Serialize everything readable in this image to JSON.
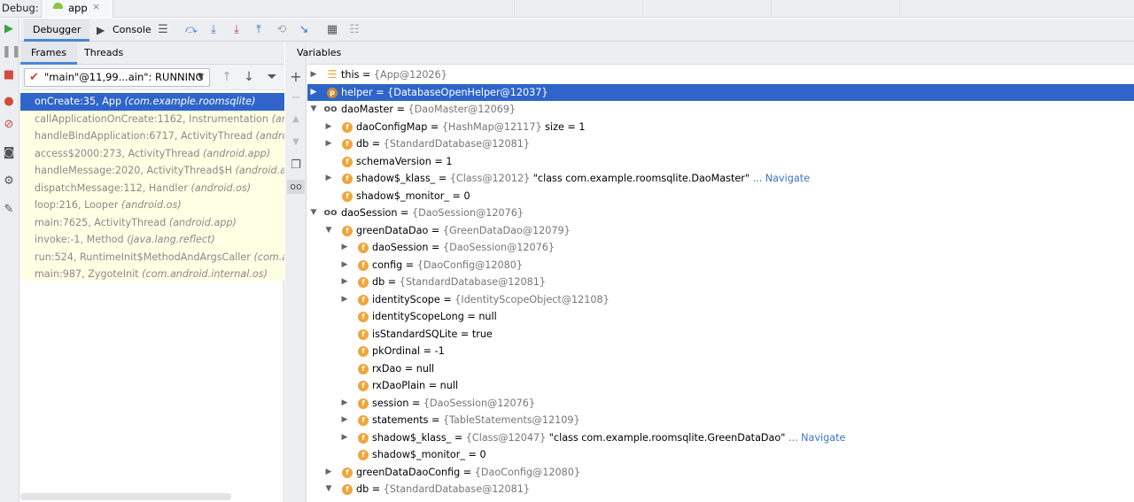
{
  "topbar": {
    "debug_label": "Debug:",
    "app_tab": "app",
    "close": "×"
  },
  "toolbar": {
    "debugger_tab": "Debugger",
    "console_tab": "Console"
  },
  "frames_panel": {
    "frames_tab": "Frames",
    "threads_tab": "Threads",
    "thread_value": "\"main\"@11,99...ain\": RUNNING",
    "frames": [
      {
        "method": "onCreate:35, App ",
        "pkg": "(com.example.roomsqlite)"
      },
      {
        "method": "callApplicationOnCreate:1162, Instrumentation ",
        "pkg": "(android.app)"
      },
      {
        "method": "handleBindApplication:6717, ActivityThread ",
        "pkg": "(android.app)"
      },
      {
        "method": "access$2000:273, ActivityThread ",
        "pkg": "(android.app)"
      },
      {
        "method": "handleMessage:2020, ActivityThread$H ",
        "pkg": "(android.app)"
      },
      {
        "method": "dispatchMessage:112, Handler ",
        "pkg": "(android.os)"
      },
      {
        "method": "loop:216, Looper ",
        "pkg": "(android.os)"
      },
      {
        "method": "main:7625, ActivityThread ",
        "pkg": "(android.app)"
      },
      {
        "method": "invoke:-1, Method ",
        "pkg": "(java.lang.reflect)"
      },
      {
        "method": "run:524, RuntimeInit$MethodAndArgsCaller ",
        "pkg": "(com.android.internal.os)"
      },
      {
        "method": "main:987, ZygoteInit ",
        "pkg": "(com.android.internal.os)"
      }
    ]
  },
  "variables_panel": {
    "title": "Variables",
    "rows": [
      {
        "name": "this",
        "value": "{App@12026}",
        "extra": "",
        "nav": ""
      },
      {
        "name": "helper",
        "value": "{DatabaseOpenHelper@12037}",
        "extra": "",
        "nav": ""
      },
      {
        "name": "daoMaster",
        "value": "{DaoMaster@12069}",
        "extra": "",
        "nav": ""
      },
      {
        "name": "daoConfigMap",
        "value": "{HashMap@12117}",
        "extra": " size = 1",
        "nav": ""
      },
      {
        "name": "db",
        "value": "{StandardDatabase@12081}",
        "extra": "",
        "nav": ""
      },
      {
        "name": "schemaVersion",
        "value": "",
        "extra": "1",
        "nav": ""
      },
      {
        "name": "shadow$_klass_",
        "value": "{Class@12012}",
        "extra": " \"class com.example.roomsqlite.DaoMaster\"",
        "nav": "... Navigate"
      },
      {
        "name": "shadow$_monitor_",
        "value": "",
        "extra": "0",
        "nav": ""
      },
      {
        "name": "daoSession",
        "value": "{DaoSession@12076}",
        "extra": "",
        "nav": ""
      },
      {
        "name": "greenDataDao",
        "value": "{GreenDataDao@12079}",
        "extra": "",
        "nav": ""
      },
      {
        "name": "daoSession",
        "value": "{DaoSession@12076}",
        "extra": "",
        "nav": ""
      },
      {
        "name": "config",
        "value": "{DaoConfig@12080}",
        "extra": "",
        "nav": ""
      },
      {
        "name": "db",
        "value": "{StandardDatabase@12081}",
        "extra": "",
        "nav": ""
      },
      {
        "name": "identityScope",
        "value": "{IdentityScopeObject@12108}",
        "extra": "",
        "nav": ""
      },
      {
        "name": "identityScopeLong",
        "value": "",
        "extra": "null",
        "nav": ""
      },
      {
        "name": "isStandardSQLite",
        "value": "",
        "extra": "true",
        "nav": ""
      },
      {
        "name": "pkOrdinal",
        "value": "",
        "extra": "-1",
        "nav": ""
      },
      {
        "name": "rxDao",
        "value": "",
        "extra": "null",
        "nav": ""
      },
      {
        "name": "rxDaoPlain",
        "value": "",
        "extra": "null",
        "nav": ""
      },
      {
        "name": "session",
        "value": "{DaoSession@12076}",
        "extra": "",
        "nav": ""
      },
      {
        "name": "statements",
        "value": "{TableStatements@12109}",
        "extra": "",
        "nav": ""
      },
      {
        "name": "shadow$_klass_",
        "value": "{Class@12047}",
        "extra": " \"class com.example.roomsqlite.GreenDataDao\"",
        "nav": "... Navigate"
      },
      {
        "name": "shadow$_monitor_",
        "value": "",
        "extra": "0",
        "nav": ""
      },
      {
        "name": "greenDataDaoConfig",
        "value": "{DaoConfig@12080}",
        "extra": "",
        "nav": ""
      },
      {
        "name": "db",
        "value": "{StandardDatabase@12081}",
        "extra": "",
        "nav": ""
      }
    ]
  }
}
